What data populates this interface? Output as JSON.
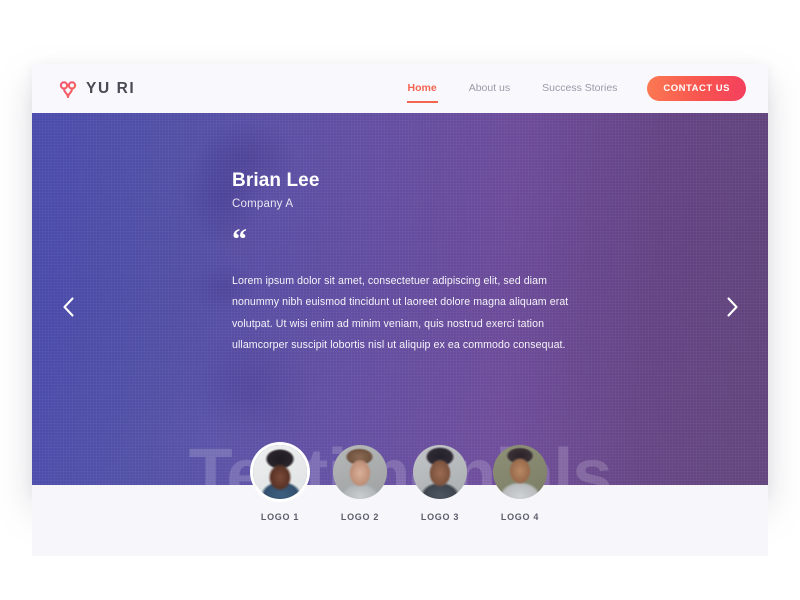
{
  "brand": {
    "name": "YU RI",
    "mark": "yuri-logo-icon",
    "accent": "#f4654f"
  },
  "nav": {
    "items": [
      {
        "label": "Home",
        "active": true
      },
      {
        "label": "About us",
        "active": false
      },
      {
        "label": "Success Stories",
        "active": false
      }
    ],
    "cta_label": "CONTACT US",
    "cta_gradient_from": "#fb7a53",
    "cta_gradient_to": "#f43f5e"
  },
  "hero": {
    "watermark": "Testimonials",
    "prev_icon": "chevron-left-icon",
    "next_icon": "chevron-right-icon",
    "gradient_from": "#4242aa",
    "gradient_to": "#5c3d77"
  },
  "testimonial": {
    "name": "Brian Lee",
    "company": "Company A",
    "quote_glyph": "“",
    "body": "Lorem ipsum dolor sit amet, consectetuer adipiscing elit, sed diam nonummy nibh euismod tincidunt ut laoreet dolore magna aliquam erat volutpat. Ut wisi enim ad minim veniam, quis nostrud exerci tation ullamcorper suscipit lobortis nisl ut aliquip ex ea commodo consequat."
  },
  "thumbnails": [
    {
      "label": "LOGO 1",
      "active": true,
      "face": "f1"
    },
    {
      "label": "LOGO 2",
      "active": false,
      "face": "f2"
    },
    {
      "label": "LOGO 3",
      "active": false,
      "face": "f3"
    },
    {
      "label": "LOGO 4",
      "active": false,
      "face": "f4"
    }
  ]
}
